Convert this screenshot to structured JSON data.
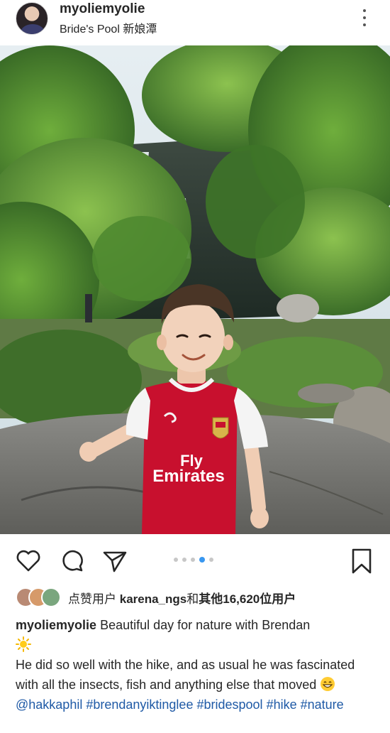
{
  "header": {
    "username": "myoliemyolie",
    "location": "Bride's Pool 新娘潭"
  },
  "post": {
    "jersey_sponsor_line1": "Fly",
    "jersey_sponsor_line2": "Emirates"
  },
  "carousel": {
    "total": 5,
    "active_index": 3
  },
  "likes": {
    "prefix": "点赞用户 ",
    "user": "karena_ngs",
    "middle": "和",
    "others": "其他16,620位用户"
  },
  "caption": {
    "username": "myoliemyolie",
    "text1": "Beautiful day for nature with Brendan",
    "text2": "He did so well with the hike, and as usual he was fascinated with all the insects, fish and anything else that moved",
    "mention": "@hakkaphil",
    "tag1": "#brendanyiktinglee",
    "tag2": "#bridespool",
    "tag3": "#hike",
    "tag4": "#nature"
  },
  "icons": {
    "like": "heart-icon",
    "comment": "comment-bubble-icon",
    "share": "paper-plane-icon",
    "save": "bookmark-icon",
    "more": "more-options-icon"
  },
  "colors": {
    "link": "#1f5aa6",
    "active_dot": "#3897f0",
    "jersey_red": "#c8102e"
  }
}
